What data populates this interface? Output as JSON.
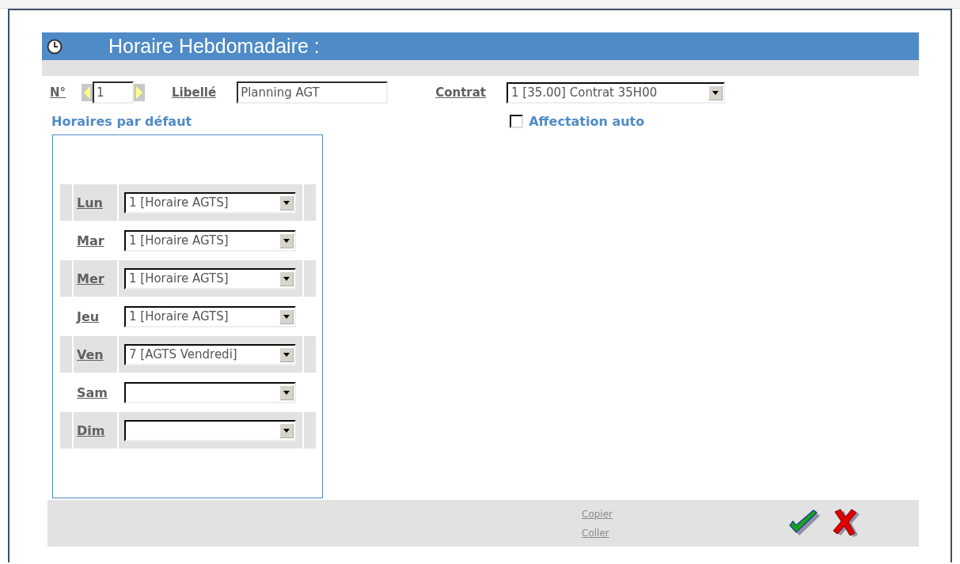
{
  "header": {
    "title": "Horaire Hebdomadaire :"
  },
  "form": {
    "number_label": "N°",
    "number_value": "1",
    "libelle_label": "Libellé",
    "libelle_value": "Planning AGT",
    "contrat_label": "Contrat",
    "contrat_value": "1 [35.00] Contrat 35H00"
  },
  "defaults": {
    "title": "Horaires par défaut",
    "days": [
      {
        "label": "Lun",
        "value": "1 [Horaire AGTS]"
      },
      {
        "label": "Mar",
        "value": "1 [Horaire AGTS]"
      },
      {
        "label": "Mer",
        "value": "1 [Horaire AGTS]"
      },
      {
        "label": "Jeu",
        "value": "1 [Horaire AGTS]"
      },
      {
        "label": "Ven",
        "value": "7 [AGTS Vendredi]"
      },
      {
        "label": "Sam"
      },
      {
        "label": "Dim"
      }
    ]
  },
  "auto_assign": {
    "label": "Affectation auto",
    "checked": false
  },
  "footer": {
    "links": [
      "Copier",
      "Coller"
    ]
  }
}
